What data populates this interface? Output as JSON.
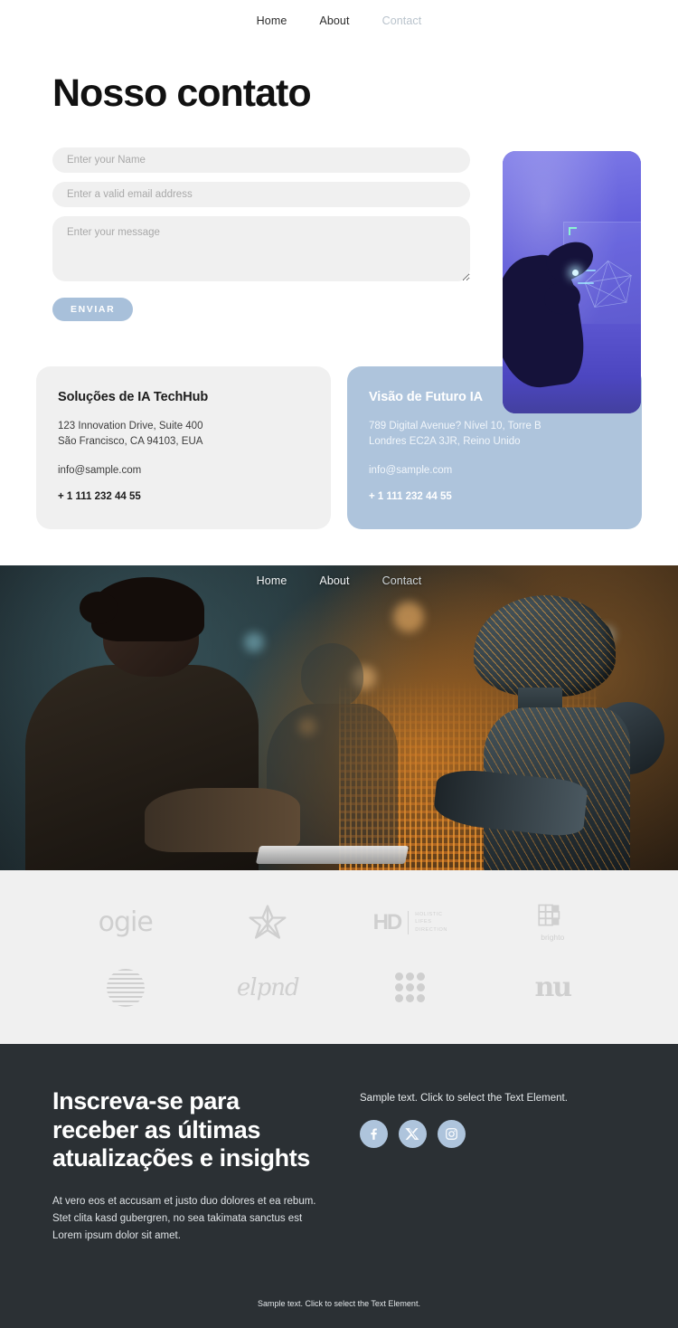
{
  "nav": {
    "items": [
      {
        "label": "Home",
        "muted": false
      },
      {
        "label": "About",
        "muted": false
      },
      {
        "label": "Contact",
        "muted": true
      }
    ]
  },
  "hero": {
    "title": "Nosso contato",
    "form": {
      "name_placeholder": "Enter your Name",
      "email_placeholder": "Enter a valid email address",
      "message_placeholder": "Enter your message",
      "submit_label": "ENVIAR"
    },
    "side_image_alt": "hand-touching-holographic-screen"
  },
  "cards": [
    {
      "title": "Soluções de IA TechHub",
      "address_line1": "123 Innovation Drive, Suite 400",
      "address_line2": "São Francisco, CA 94103, EUA",
      "email": "info@sample.com",
      "phone": "+ 1 111 232 44 55"
    },
    {
      "title": "Visão de Futuro IA",
      "address_line1": "789 Digital Avenue? Nível 10, Torre B",
      "address_line2": "Londres EC2A 3JR, Reino Unido",
      "email": "info@sample.com",
      "phone": "+ 1 111 232 44 55"
    }
  ],
  "banner": {
    "alt": "woman-working-with-ai-robot",
    "nav": [
      {
        "label": "Home",
        "muted": false
      },
      {
        "label": "About",
        "muted": false
      },
      {
        "label": "Contact",
        "muted": true
      }
    ]
  },
  "logos": {
    "row1": [
      {
        "name": "ogie",
        "text": "ogie",
        "kind": "wordmark"
      },
      {
        "name": "flower",
        "text": "",
        "kind": "mark"
      },
      {
        "name": "holistic-lifes-direction",
        "mark": "HD",
        "line1": "HOLISTIC",
        "line2": "LIFES",
        "line3": "DIRECTION",
        "kind": "lockup"
      },
      {
        "name": "brighto",
        "text": "brighto",
        "kind": "lockup"
      }
    ],
    "row2": [
      {
        "name": "striped-sphere",
        "text": "",
        "kind": "mark"
      },
      {
        "name": "elpnd",
        "text": "elpnd",
        "kind": "script"
      },
      {
        "name": "dots",
        "text": "",
        "kind": "mark"
      },
      {
        "name": "nu",
        "text": "nu",
        "kind": "wordmark"
      }
    ]
  },
  "footer": {
    "title": "Inscreva-se para receber as últimas atualizações e insights",
    "body": "At vero eos et accusam et justo duo dolores et ea rebum. Stet clita kasd gubergren, no sea takimata sanctus est Lorem ipsum dolor sit amet.",
    "sample_text": "Sample text. Click to select the Text Element.",
    "socials": [
      {
        "name": "facebook",
        "label": "Facebook"
      },
      {
        "name": "x-twitter",
        "label": "X"
      },
      {
        "name": "instagram",
        "label": "Instagram"
      }
    ],
    "bottom_text": "Sample text. Click to select the Text Element."
  },
  "colors": {
    "accent_blue": "#aec4dc",
    "card_light": "#f0f0f0",
    "footer_bg": "#2b3034",
    "logos_bg": "#f0f0f0"
  }
}
